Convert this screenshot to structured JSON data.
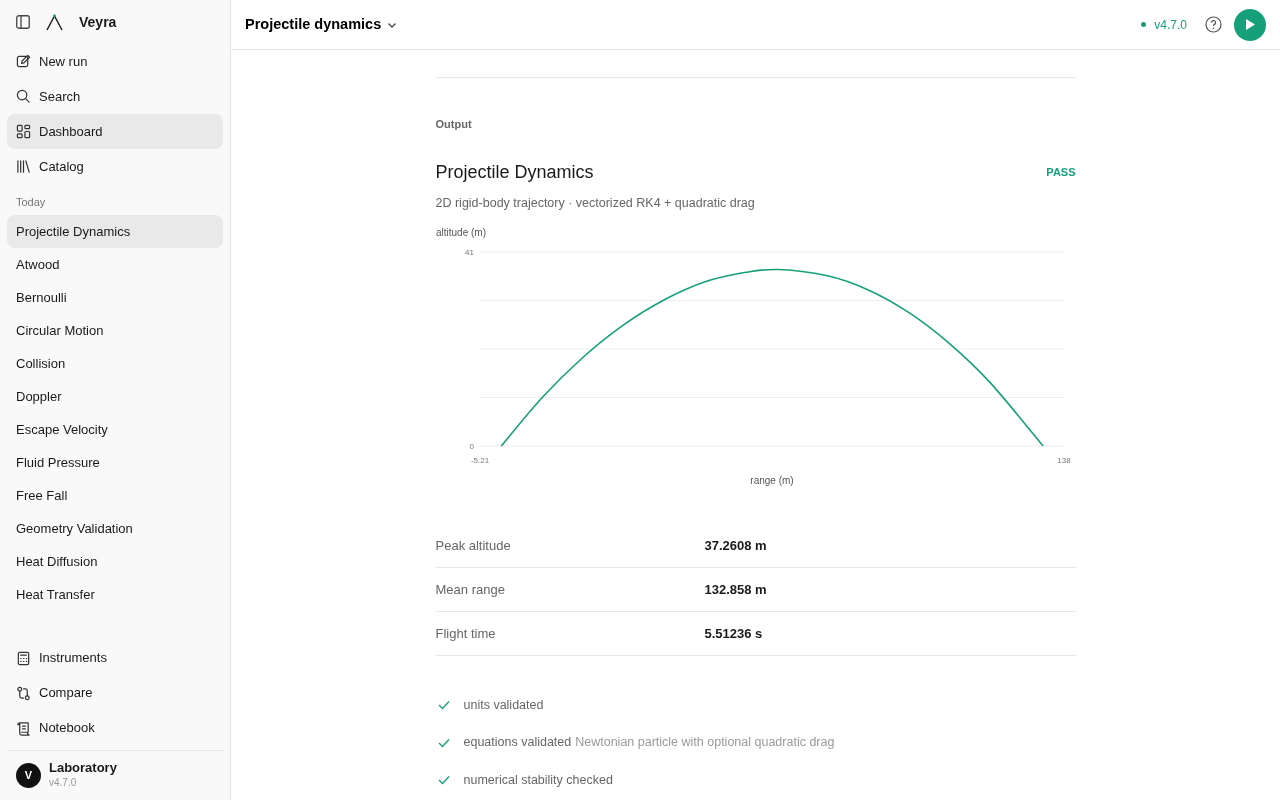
{
  "sidebar": {
    "brand": "Veyra",
    "nav": [
      {
        "label": "New run",
        "selected": false
      },
      {
        "label": "Search",
        "selected": false
      },
      {
        "label": "Dashboard",
        "selected": true
      },
      {
        "label": "Catalog",
        "selected": false
      }
    ],
    "history_heading": "Today",
    "history": [
      {
        "label": "Projectile Dynamics",
        "selected": true
      },
      {
        "label": "Atwood",
        "selected": false
      },
      {
        "label": "Bernoulli",
        "selected": false
      },
      {
        "label": "Circular Motion",
        "selected": false
      },
      {
        "label": "Collision",
        "selected": false
      },
      {
        "label": "Doppler",
        "selected": false
      },
      {
        "label": "Escape Velocity",
        "selected": false
      },
      {
        "label": "Fluid Pressure",
        "selected": false
      },
      {
        "label": "Free Fall",
        "selected": false
      },
      {
        "label": "Geometry Validation",
        "selected": false
      },
      {
        "label": "Heat Diffusion",
        "selected": false
      },
      {
        "label": "Heat Transfer",
        "selected": false
      }
    ],
    "tools": [
      {
        "label": "Instruments"
      },
      {
        "label": "Compare"
      },
      {
        "label": "Notebook"
      }
    ],
    "user": {
      "avatar": "V",
      "name": "Laboratory",
      "version": "v4.7.0"
    }
  },
  "header": {
    "title": "Projectile dynamics",
    "version": "v4.7.0"
  },
  "output": {
    "section": "Output",
    "title": "Projectile Dynamics",
    "status": "PASS",
    "subtitle": "2D rigid-body trajectory · vectorized RK4 + quadratic drag",
    "chart_data": {
      "type": "line",
      "xlabel": "range (m)",
      "ylabel": "altitude (m)",
      "xlim": [
        -5.21,
        138
      ],
      "ylim": [
        0,
        41
      ],
      "xticks": [
        -5.21,
        138
      ],
      "yticks": [
        0,
        41
      ],
      "x": [
        0,
        10,
        20,
        30,
        40,
        50,
        60,
        68,
        80,
        90,
        100,
        110,
        120,
        132.86
      ],
      "series": [
        {
          "color": "#16a07a",
          "values": [
            0,
            10.2,
            18.7,
            25.6,
            30.9,
            34.7,
            36.7,
            37.3,
            36,
            33,
            28.2,
            21.6,
            13.3,
            0
          ]
        }
      ]
    },
    "metrics": [
      {
        "label": "Peak altitude",
        "value": "37.2608 m"
      },
      {
        "label": "Mean range",
        "value": "132.858 m"
      },
      {
        "label": "Flight time",
        "value": "5.51236 s"
      }
    ],
    "checks": [
      {
        "label": "units validated",
        "passed": true
      },
      {
        "label": "equations validated",
        "detail": "Newtonian particle with optional quadratic drag",
        "passed": true
      },
      {
        "label": "numerical stability checked",
        "passed": true
      }
    ]
  }
}
